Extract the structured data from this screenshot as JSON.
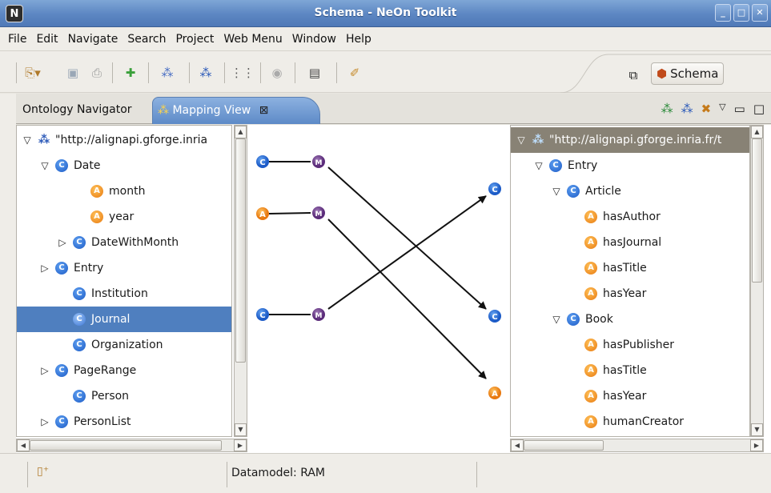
{
  "window": {
    "title": "Schema - NeOn Toolkit",
    "logo": "N"
  },
  "menu": [
    "File",
    "Edit",
    "Navigate",
    "Search",
    "Project",
    "Web Menu",
    "Window",
    "Help"
  ],
  "toolbar": {
    "perspective_label": "Schema"
  },
  "tabs": {
    "navigator": "Ontology Navigator",
    "mapping": "Mapping View",
    "close_glyph": "⊠"
  },
  "left_tree": {
    "root": "\"http://alignapi.gforge.inria",
    "items": [
      {
        "label": "Date",
        "kind": "class",
        "depth": 1,
        "twisty": "▽"
      },
      {
        "label": "month",
        "kind": "attr",
        "depth": 3,
        "twisty": ""
      },
      {
        "label": "year",
        "kind": "attr",
        "depth": 3,
        "twisty": ""
      },
      {
        "label": "DateWithMonth",
        "kind": "class",
        "depth": 2,
        "twisty": "▷"
      },
      {
        "label": "Entry",
        "kind": "class",
        "depth": 1,
        "twisty": "▷"
      },
      {
        "label": "Institution",
        "kind": "class",
        "depth": 2,
        "twisty": ""
      },
      {
        "label": "Journal",
        "kind": "class",
        "depth": 2,
        "twisty": "",
        "selected": true
      },
      {
        "label": "Organization",
        "kind": "class",
        "depth": 2,
        "twisty": ""
      },
      {
        "label": "PageRange",
        "kind": "class",
        "depth": 1,
        "twisty": "▷"
      },
      {
        "label": "Person",
        "kind": "class",
        "depth": 2,
        "twisty": ""
      },
      {
        "label": "PersonList",
        "kind": "class",
        "depth": 1,
        "twisty": "▷"
      }
    ]
  },
  "right_tree": {
    "root": "\"http://alignapi.gforge.inria.fr/t",
    "items": [
      {
        "label": "Entry",
        "kind": "class",
        "depth": 1,
        "twisty": "▽"
      },
      {
        "label": "Article",
        "kind": "class",
        "depth": 2,
        "twisty": "▽"
      },
      {
        "label": "hasAuthor",
        "kind": "attr",
        "depth": 3,
        "twisty": ""
      },
      {
        "label": "hasJournal",
        "kind": "attr",
        "depth": 3,
        "twisty": ""
      },
      {
        "label": "hasTitle",
        "kind": "attr",
        "depth": 3,
        "twisty": ""
      },
      {
        "label": "hasYear",
        "kind": "attr",
        "depth": 3,
        "twisty": ""
      },
      {
        "label": "Book",
        "kind": "class",
        "depth": 2,
        "twisty": "▽"
      },
      {
        "label": "hasPublisher",
        "kind": "attr",
        "depth": 3,
        "twisty": ""
      },
      {
        "label": "hasTitle",
        "kind": "attr",
        "depth": 3,
        "twisty": ""
      },
      {
        "label": "hasYear",
        "kind": "attr",
        "depth": 3,
        "twisty": ""
      },
      {
        "label": "humanCreator",
        "kind": "attr",
        "depth": 3,
        "twisty": ""
      }
    ]
  },
  "mapping_glyphs": {
    "class": "C",
    "attr": "A",
    "mapping": "M"
  },
  "status": {
    "datamodel": "Datamodel: RAM"
  }
}
